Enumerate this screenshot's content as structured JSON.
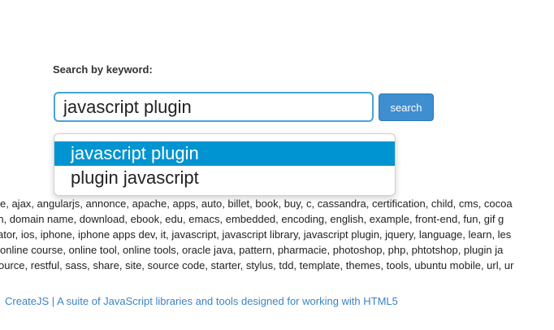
{
  "search": {
    "label": "Search by keyword:",
    "value": "javascript plugin",
    "button_label": "search"
  },
  "suggestions": [
    {
      "label": "javascript plugin",
      "highlighted": true
    },
    {
      "label": "plugin javascript",
      "highlighted": false
    }
  ],
  "tag_lines": [
    "e, ajax, angularjs, annonce, apache, apps, auto, billet, book, buy, c, cassandra, certification, child, cms, cocoa",
    "rn, domain name, download, ebook, edu, emacs, embedded, encoding, english, example, front-end, fun, gif g",
    "ator, ios, iphone, iphone apps dev, it, javascript, javascript library, javascript plugin, jquery, language, learn, les",
    "online course, online tool, online tools, oracle java, pattern, pharmacie, photoshop, php, phtotshop, plugin ja",
    "ource, restful, sass, share, site, source code, starter, stylus, tdd, template, themes, tools, ubuntu mobile, url, ur"
  ],
  "result": {
    "link_text": "CreateJS | A suite of JavaScript libraries and tools designed for working with HTML5"
  },
  "colors": {
    "accent": "#0094d0",
    "button": "#3f8ed0",
    "link": "#3b84c4",
    "input_border": "#4aa3d8"
  }
}
